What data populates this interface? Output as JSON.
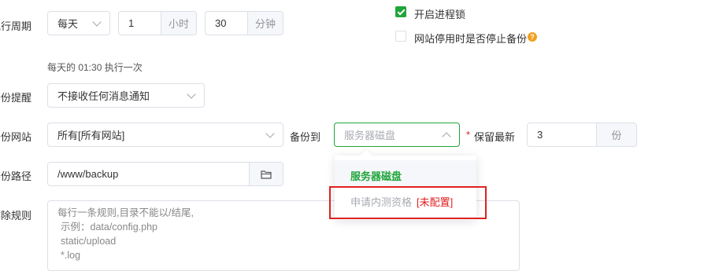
{
  "cycle": {
    "label": "执行周期",
    "period_value": "每天",
    "hours_value": "1",
    "hours_unit": "小时",
    "minutes_value": "30",
    "minutes_unit": "分钟",
    "hint": "每天的 01:30 执行一次"
  },
  "options": {
    "process_lock_label": "开启进程锁",
    "process_lock_checked": true,
    "stop_backup_label": "网站停用时是否停止备份",
    "stop_backup_checked": false,
    "help_glyph": "?"
  },
  "reminder": {
    "label": "备份提醒",
    "value": "不接收任何消息通知"
  },
  "site": {
    "label": "备份网站",
    "value": "所有[所有网站]",
    "backup_to_label": "备份到",
    "backup_to_placeholder": "服务器磁盘",
    "required_mark": "*",
    "keep_label": "保留最新",
    "keep_value": "3",
    "keep_unit": "份"
  },
  "path": {
    "label": "备份路径",
    "value": "/www/backup"
  },
  "exclude": {
    "label": "排除规则",
    "placeholder_lines": [
      "每行一条规则,目录不能以/结尾,",
      "示例：data/config.php",
      "static/upload",
      "*.log"
    ]
  },
  "dropdown": {
    "option_1": "服务器磁盘",
    "option_2": "申请内测资格",
    "option_2_tag": "[未配置]"
  },
  "colors": {
    "accent": "#20a53a",
    "danger": "#e02020",
    "highlight_box": "#e02020"
  }
}
